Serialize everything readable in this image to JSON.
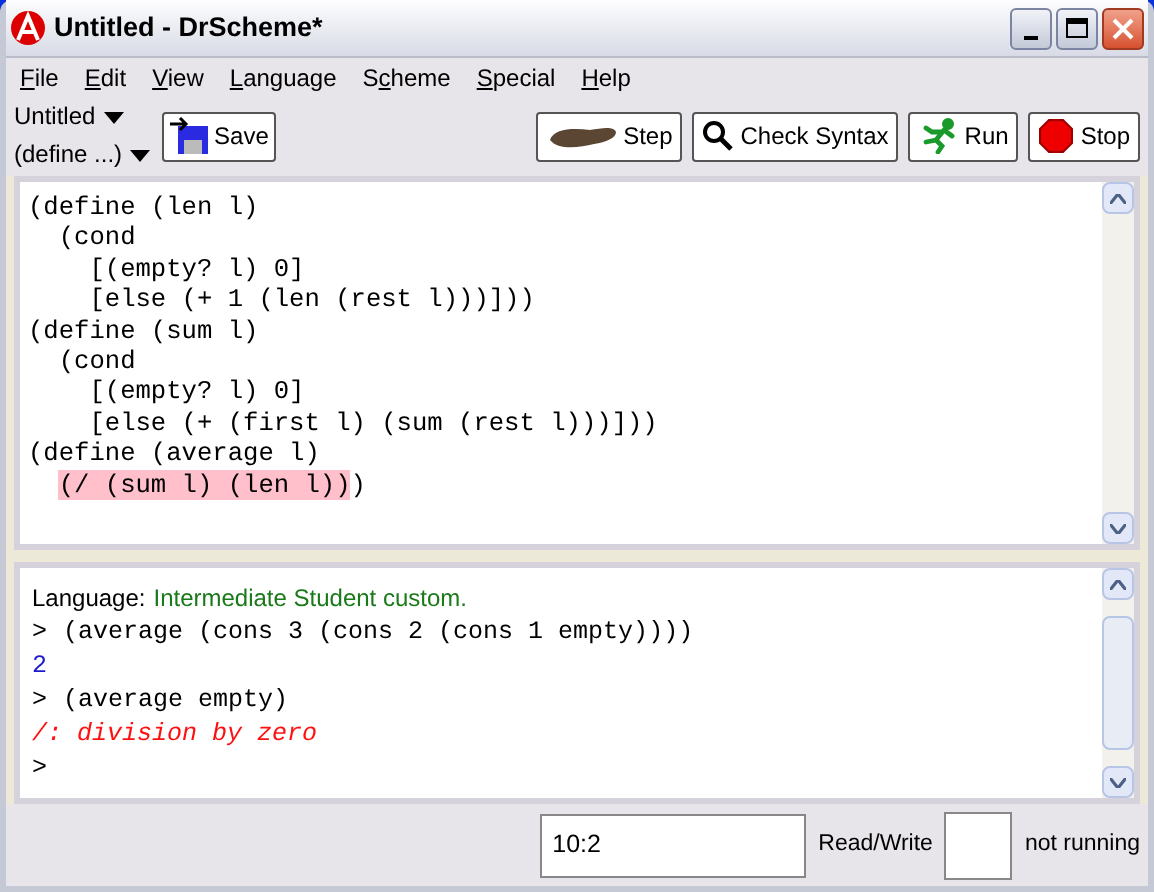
{
  "window": {
    "title": "Untitled - DrScheme*"
  },
  "menu": [
    [
      {
        "text": "F",
        "underlined": true
      },
      {
        "text": "ile",
        "underlined": false
      }
    ],
    [
      {
        "text": "E",
        "underlined": true
      },
      {
        "text": "dit",
        "underlined": false
      }
    ],
    [
      {
        "text": "V",
        "underlined": true
      },
      {
        "text": "iew",
        "underlined": false
      }
    ],
    [
      {
        "text": "L",
        "underlined": true
      },
      {
        "text": "anguage",
        "underlined": false
      }
    ],
    [
      {
        "text": "S",
        "underlined": false
      },
      {
        "text": "c",
        "underlined": true
      },
      {
        "text": "heme",
        "underlined": false
      }
    ],
    [
      {
        "text": "S",
        "underlined": true
      },
      {
        "text": "pecial",
        "underlined": false
      }
    ],
    [
      {
        "text": "H",
        "underlined": true
      },
      {
        "text": "elp",
        "underlined": false
      }
    ]
  ],
  "toolbar": {
    "file_menu": "Untitled",
    "define_menu": "(define ...)",
    "save": "Save",
    "buttons": [
      {
        "kind": "step",
        "label": "Step"
      },
      {
        "kind": "check",
        "label": "Check Syntax"
      },
      {
        "kind": "run",
        "label": "Run"
      },
      {
        "kind": "stop",
        "label": "Stop"
      }
    ]
  },
  "definitions": [
    [
      {
        "text": "(define (len l)",
        "highlighted": false
      }
    ],
    [
      {
        "text": "  (cond",
        "highlighted": false
      }
    ],
    [
      {
        "text": "    [(empty? l) 0]",
        "highlighted": false
      }
    ],
    [
      {
        "text": "    [else (+ 1 (len (rest l)))]))",
        "highlighted": false
      }
    ],
    [
      {
        "text": "(define (sum l)",
        "highlighted": false
      }
    ],
    [
      {
        "text": "  (cond",
        "highlighted": false
      }
    ],
    [
      {
        "text": "    [(empty? l) 0]",
        "highlighted": false
      }
    ],
    [
      {
        "text": "    [else (+ (first l) (sum (rest l)))]))",
        "highlighted": false
      }
    ],
    [
      {
        "text": "(define (average l)",
        "highlighted": false
      }
    ],
    [
      {
        "text": "  (/ (sum l) (len l))",
        "highlighted": true
      },
      {
        "text": ")",
        "highlighted": false
      }
    ]
  ],
  "interactions": [
    {
      "kind": "language",
      "label": "Language:",
      "value": "Intermediate Student custom."
    },
    {
      "kind": "input",
      "prompt": ">",
      "text": "(average (cons 3 (cons 2 (cons 1 empty))))"
    },
    {
      "kind": "result",
      "text": "2"
    },
    {
      "kind": "input",
      "prompt": ">",
      "text": "(average empty)"
    },
    {
      "kind": "error",
      "text": "/: division by zero"
    },
    {
      "kind": "input",
      "prompt": ">"
    }
  ],
  "status_bar": {
    "position": "10:2",
    "mode": "Read/Write",
    "state": "not running"
  }
}
